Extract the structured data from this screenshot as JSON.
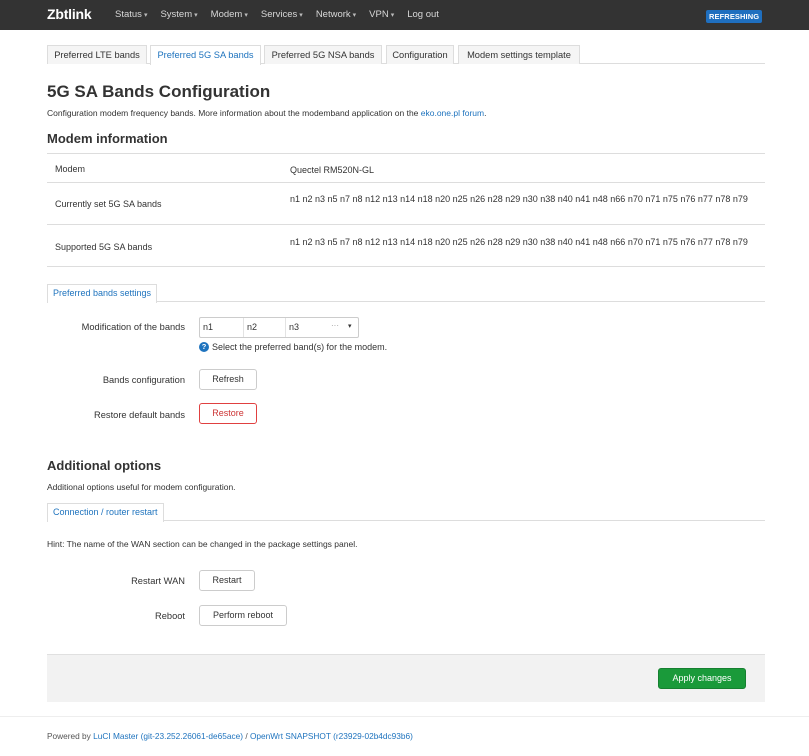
{
  "nav": {
    "brand": "Zbtlink",
    "menu": [
      {
        "label": "Status",
        "dropdown": true
      },
      {
        "label": "System",
        "dropdown": true
      },
      {
        "label": "Modem",
        "dropdown": true
      },
      {
        "label": "Services",
        "dropdown": true
      },
      {
        "label": "Network",
        "dropdown": true
      },
      {
        "label": "VPN",
        "dropdown": true
      },
      {
        "label": "Log out",
        "dropdown": false
      }
    ],
    "refresh_badge": "REFRESHING",
    "dropdown_caret": "▾"
  },
  "tabs": [
    {
      "label": "Preferred LTE bands",
      "active": false
    },
    {
      "label": "Preferred 5G SA bands",
      "active": true
    },
    {
      "label": "Preferred 5G NSA bands",
      "active": false
    },
    {
      "label": "Configuration",
      "active": false
    },
    {
      "label": "Modem settings template",
      "active": false
    }
  ],
  "page": {
    "title": "5G SA Bands Configuration",
    "intro_text": "Configuration modem frequency bands. More information about the modemband application on the ",
    "intro_link": "eko.one.pl forum",
    "intro_end": "."
  },
  "modem_info": {
    "heading": "Modem information",
    "rows": [
      {
        "key": "Modem",
        "value": "Quectel RM520N-GL"
      },
      {
        "key": "Currently set 5G SA bands",
        "value": "n1 n2 n3 n5 n7 n8 n12 n13 n14 n18 n20 n25 n26 n28 n29 n30 n38 n40 n41 n48 n66 n70 n71 n75 n76 n77 n78 n79"
      },
      {
        "key": "Supported 5G SA bands",
        "value": "n1 n2 n3 n5 n7 n8 n12 n13 n14 n18 n20 n25 n26 n28 n29 n30 n38 n40 n41 n48 n66 n70 n71 n75 n76 n77 n78 n79"
      }
    ]
  },
  "preferred": {
    "tab_label": "Preferred bands settings",
    "modification_label": "Modification of the bands",
    "selected_bands": [
      "n1",
      "n2",
      "n3"
    ],
    "more_indicator": "···",
    "select_arrow": "▾",
    "help_icon": "?",
    "help_text": "Select the preferred band(s) for the modem.",
    "bands_config_label": "Bands configuration",
    "refresh_button": "Refresh",
    "restore_label": "Restore default bands",
    "restore_button": "Restore"
  },
  "additional": {
    "heading": "Additional options",
    "description": "Additional options useful for modem configuration.",
    "tab_label": "Connection / router restart",
    "hint": "Hint: The name of the WAN section can be changed in the package settings panel.",
    "restart_wan_label": "Restart WAN",
    "restart_wan_button": "Restart",
    "reboot_label": "Reboot",
    "reboot_button": "Perform reboot"
  },
  "apply_button": "Apply changes",
  "footer": {
    "prefix": "Powered by ",
    "luci_link": "LuCI Master (git-23.252.26061-de65ace)",
    "separator": " / ",
    "openwrt_link": "OpenWrt SNAPSHOT (r23929-02b4dc93b6)"
  }
}
